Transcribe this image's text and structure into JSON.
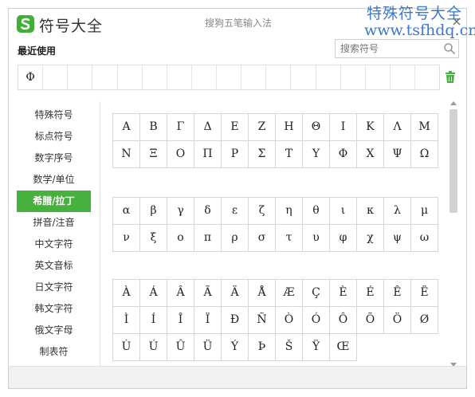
{
  "window": {
    "title": "符号大全",
    "ime_name": "搜狗五笔输入法",
    "close_glyph": "×"
  },
  "watermark": {
    "line1": "特殊符号大全",
    "line2": "www.tsfhdq.cn"
  },
  "recent": {
    "label": "最近使用",
    "symbols": [
      "Φ",
      "",
      "",
      "",
      "",
      "",
      "",
      "",
      "",
      "",
      "",
      "",
      "",
      "",
      "",
      "",
      ""
    ]
  },
  "search": {
    "placeholder": "搜索符号",
    "value": ""
  },
  "sidebar": {
    "items": [
      {
        "label": "特殊符号",
        "active": false
      },
      {
        "label": "标点符号",
        "active": false
      },
      {
        "label": "数字序号",
        "active": false
      },
      {
        "label": "数学/单位",
        "active": false
      },
      {
        "label": "希腊/拉丁",
        "active": true
      },
      {
        "label": "拼音/注音",
        "active": false
      },
      {
        "label": "中文字符",
        "active": false
      },
      {
        "label": "英文音标",
        "active": false
      },
      {
        "label": "日文字符",
        "active": false
      },
      {
        "label": "韩文字符",
        "active": false
      },
      {
        "label": "俄文字母",
        "active": false
      },
      {
        "label": "制表符",
        "active": false
      }
    ]
  },
  "groups": [
    {
      "name": "greek-uppercase",
      "symbols": [
        "Α",
        "Β",
        "Γ",
        "Δ",
        "Ε",
        "Ζ",
        "Η",
        "Θ",
        "Ι",
        "Κ",
        "Λ",
        "Μ",
        "Ν",
        "Ξ",
        "Ο",
        "Π",
        "Ρ",
        "Σ",
        "Τ",
        "Υ",
        "Φ",
        "Χ",
        "Ψ",
        "Ω"
      ]
    },
    {
      "name": "greek-lowercase",
      "symbols": [
        "α",
        "β",
        "γ",
        "δ",
        "ε",
        "ζ",
        "η",
        "θ",
        "ι",
        "κ",
        "λ",
        "μ",
        "ν",
        "ξ",
        "ο",
        "π",
        "ρ",
        "σ",
        "τ",
        "υ",
        "φ",
        "χ",
        "ψ",
        "ω"
      ]
    },
    {
      "name": "latin-accented",
      "symbols": [
        "À",
        "Á",
        "Â",
        "Ã",
        "Ä",
        "Å",
        "Æ",
        "Ç",
        "È",
        "É",
        "Ê",
        "Ë",
        "Ì",
        "Í",
        "Î",
        "Ï",
        "Ð",
        "Ñ",
        "Ò",
        "Ó",
        "Ô",
        "Õ",
        "Ö",
        "Ø",
        "Ù",
        "Ú",
        "Û",
        "Ü",
        "Ý",
        "Þ",
        "Š",
        "Ÿ",
        "Œ"
      ]
    }
  ],
  "colors": {
    "accent": "#46b13c",
    "watermark": "#3b78c9"
  },
  "icons": {
    "logo": "sogou-s-icon",
    "search": "search-icon",
    "trash": "trash-icon",
    "close": "close-icon"
  }
}
